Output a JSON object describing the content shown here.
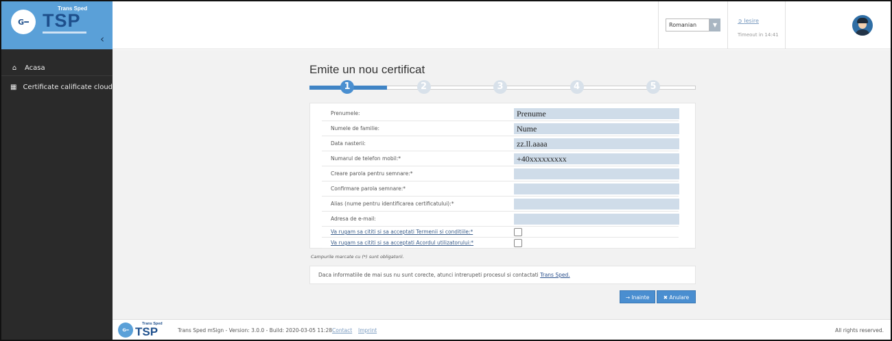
{
  "logo": {
    "brand_small": "Trans Sped",
    "brand_big": "TSP",
    "glyph": "G━"
  },
  "header": {
    "language": "Romanian",
    "logout_label": "Iesire",
    "timeout_text": "Timeout in  14:41"
  },
  "sidebar": {
    "items": [
      {
        "label": "Acasa",
        "icon": "home-icon"
      },
      {
        "label": "Certificate calificate cloud",
        "icon": "id-card-icon"
      }
    ]
  },
  "main": {
    "title": "Emite un nou certificat",
    "stepper": {
      "steps": [
        "1",
        "2",
        "3",
        "4",
        "5"
      ],
      "current": 1,
      "progress": 0.2
    },
    "fields": [
      {
        "label": "Prenumele:",
        "value": "Prenume"
      },
      {
        "label": "Numele de familie:",
        "value": "Nume"
      },
      {
        "label": "Data nasterii:",
        "value": "zz.ll.aaaa"
      },
      {
        "label": "Numarul de telefon mobil:*",
        "value": "+40xxxxxxxxx"
      },
      {
        "label": "Creare parola pentru semnare:*",
        "value": ""
      },
      {
        "label": "Confirmare parola semnare:*",
        "value": ""
      },
      {
        "label": "Alias (nume pentru identificarea certificatului):*",
        "value": ""
      },
      {
        "label": "Adresa de e-mail:",
        "value": ""
      }
    ],
    "checks": [
      {
        "label": "Va rugam sa cititi si sa acceptati Termenii si conditiile:*",
        "checked": false
      },
      {
        "label": "Va rugam sa cititi si sa acceptati Acordul utilizatorului:*",
        "checked": false
      }
    ],
    "required_note": "Campurile marcate cu (*) sunt obligatorii.",
    "info_text": "Daca informatiile de mai sus nu sunt corecte, atunci intrerupeti procesul si contactati ",
    "info_link": "Trans Sped.",
    "next_label": "→ Inainte",
    "cancel_label": "✖ Anulare"
  },
  "footer": {
    "version": "Trans Sped mSign - Version: 3.0.0 - Build: 2020-03-05 11:28",
    "contact": "Contact",
    "imprint": "Imprint",
    "rights": "All rights reserved."
  },
  "colors": {
    "accent": "#4a8ed0",
    "sidebar": "#2a2a2a",
    "logo_bg": "#5aa0d8",
    "input_bg": "#cfdce9"
  }
}
